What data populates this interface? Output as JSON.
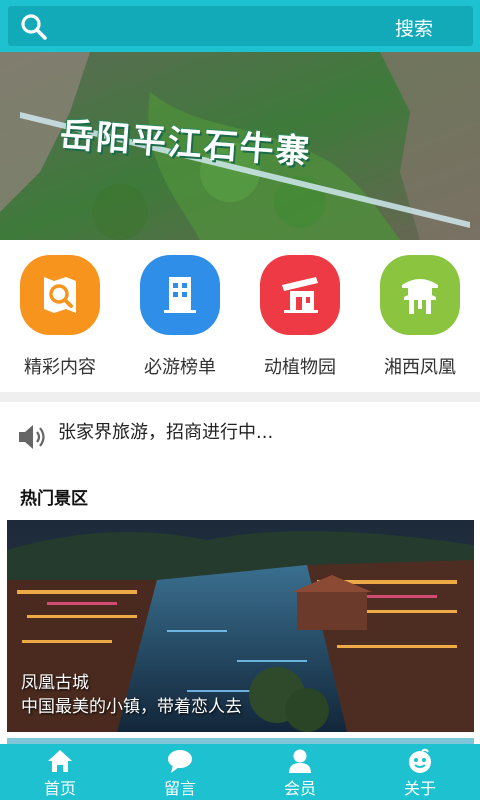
{
  "header": {
    "search_label": "搜索",
    "search_icon": "search-icon"
  },
  "banner": {
    "title": "岳阳平江石牛寨",
    "slide_count": 3,
    "active_slide": 1
  },
  "quick_nav": [
    {
      "label": "精彩内容",
      "icon": "magnifier-map-icon",
      "color": "#f7941d"
    },
    {
      "label": "必游榜单",
      "icon": "building-icon",
      "color": "#2f8fe8"
    },
    {
      "label": "动植物园",
      "icon": "pavilion-icon",
      "color": "#ee3a45"
    },
    {
      "label": "湘西凤凰",
      "icon": "gate-tower-icon",
      "color": "#8bc53f"
    }
  ],
  "notice": {
    "text": "张家界旅游，招商进行中...",
    "icon": "speaker-icon"
  },
  "hot_section": {
    "title": "热门景区",
    "items": [
      {
        "name": "凤凰古城",
        "desc": "中国最美的小镇，带着恋人去"
      }
    ]
  },
  "tabbar": [
    {
      "label": "首页",
      "icon": "home-icon"
    },
    {
      "label": "留言",
      "icon": "chat-icon"
    },
    {
      "label": "会员",
      "icon": "user-icon"
    },
    {
      "label": "关于",
      "icon": "about-icon"
    }
  ],
  "colors": {
    "accent": "#1ec1cf",
    "accent_dark": "#12aab8",
    "dot_active": "#e25a6d"
  }
}
